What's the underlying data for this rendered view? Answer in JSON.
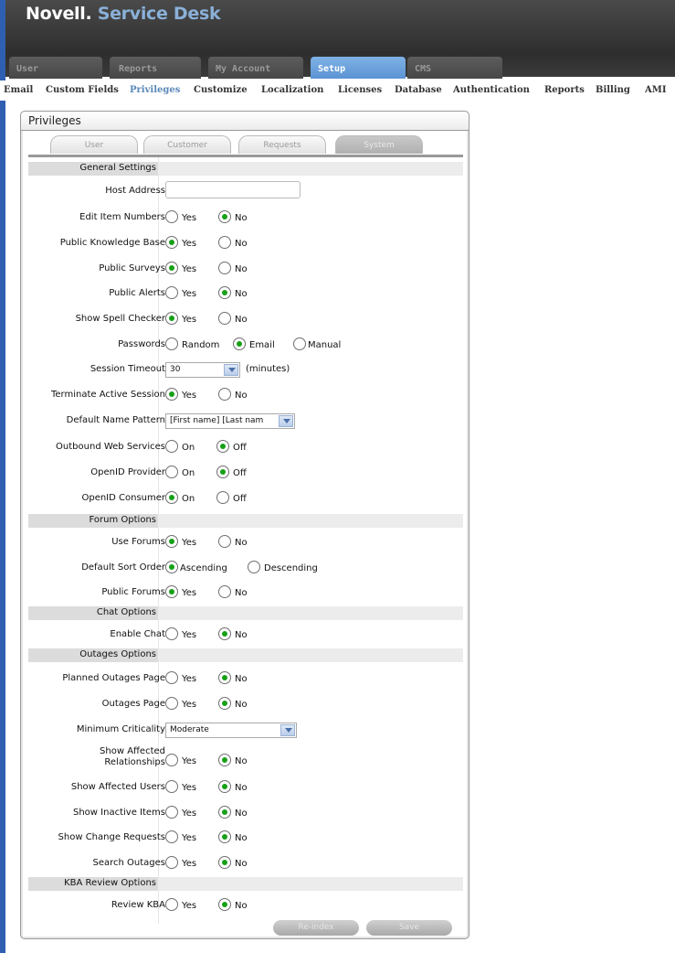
{
  "app": {
    "brand_part1": "Novell.",
    "brand_part2": "Service Desk"
  },
  "main_tabs": [
    "User",
    "Reports",
    "My Account",
    "Setup",
    "CMS"
  ],
  "active_main_tab": "Setup",
  "sub_nav": [
    "Email",
    "Custom Fields",
    "Privileges",
    "Customize",
    "Localization",
    "Licenses",
    "Database",
    "Authentication",
    "Reports",
    "Billing",
    "AMI"
  ],
  "active_sub_nav": "Privileges",
  "panel": {
    "title": "Privileges"
  },
  "tabs": [
    "User",
    "Customer",
    "Requests",
    "System"
  ],
  "active_tab": "System",
  "sections": {
    "general": "General Settings",
    "forum": "Forum Options",
    "chat": "Chat Options",
    "outages": "Outages Options",
    "kba": "KBA Review Options"
  },
  "fields": {
    "host_address": {
      "label": "Host Address",
      "value": ""
    },
    "edit_item_numbers": {
      "label": "Edit Item Numbers",
      "options": [
        "Yes",
        "No"
      ],
      "selected": "No"
    },
    "public_kb": {
      "label": "Public Knowledge Base",
      "options": [
        "Yes",
        "No"
      ],
      "selected": "Yes"
    },
    "public_surveys": {
      "label": "Public Surveys",
      "options": [
        "Yes",
        "No"
      ],
      "selected": "Yes"
    },
    "public_alerts": {
      "label": "Public Alerts",
      "options": [
        "Yes",
        "No"
      ],
      "selected": "No"
    },
    "spell_checker": {
      "label": "Show Spell Checker",
      "options": [
        "Yes",
        "No"
      ],
      "selected": "Yes"
    },
    "passwords": {
      "label": "Passwords",
      "options": [
        "Random",
        "Email",
        "Manual"
      ],
      "selected": "Email"
    },
    "session_timeout": {
      "label": "Session Timeout",
      "value": "30",
      "suffix": "(minutes)"
    },
    "terminate_session": {
      "label": "Terminate Active Session",
      "options": [
        "Yes",
        "No"
      ],
      "selected": "Yes"
    },
    "name_pattern": {
      "label": "Default Name Pattern",
      "value": "[First name] [Last nam"
    },
    "outbound_ws": {
      "label": "Outbound Web Services",
      "options": [
        "On",
        "Off"
      ],
      "selected": "Off"
    },
    "openid_provider": {
      "label": "OpenID Provider",
      "options": [
        "On",
        "Off"
      ],
      "selected": "Off"
    },
    "openid_consumer": {
      "label": "OpenID Consumer",
      "options": [
        "On",
        "Off"
      ],
      "selected": "On"
    },
    "use_forums": {
      "label": "Use Forums",
      "options": [
        "Yes",
        "No"
      ],
      "selected": "Yes"
    },
    "sort_order": {
      "label": "Default Sort Order",
      "options": [
        "Ascending",
        "Descending"
      ],
      "selected": "Ascending"
    },
    "public_forums": {
      "label": "Public Forums",
      "options": [
        "Yes",
        "No"
      ],
      "selected": "Yes"
    },
    "enable_chat": {
      "label": "Enable Chat",
      "options": [
        "Yes",
        "No"
      ],
      "selected": "No"
    },
    "planned_outages": {
      "label": "Planned Outages Page",
      "options": [
        "Yes",
        "No"
      ],
      "selected": "No"
    },
    "outages_page": {
      "label": "Outages Page",
      "options": [
        "Yes",
        "No"
      ],
      "selected": "No"
    },
    "min_criticality": {
      "label": "Minimum Criticality",
      "value": "Moderate"
    },
    "affected_rel": {
      "label_line1": "Show Affected",
      "label_line2": "Relationships",
      "options": [
        "Yes",
        "No"
      ],
      "selected": "No"
    },
    "affected_users": {
      "label": "Show Affected Users",
      "options": [
        "Yes",
        "No"
      ],
      "selected": "No"
    },
    "inactive_items": {
      "label": "Show Inactive Items",
      "options": [
        "Yes",
        "No"
      ],
      "selected": "No"
    },
    "change_requests": {
      "label": "Show Change Requests",
      "options": [
        "Yes",
        "No"
      ],
      "selected": "No"
    },
    "search_outages": {
      "label": "Search Outages",
      "options": [
        "Yes",
        "No"
      ],
      "selected": "No"
    },
    "review_kba": {
      "label": "Review KBA",
      "options": [
        "Yes",
        "No"
      ],
      "selected": "No"
    }
  },
  "buttons": {
    "reindex": "Re-index",
    "save": "Save"
  }
}
